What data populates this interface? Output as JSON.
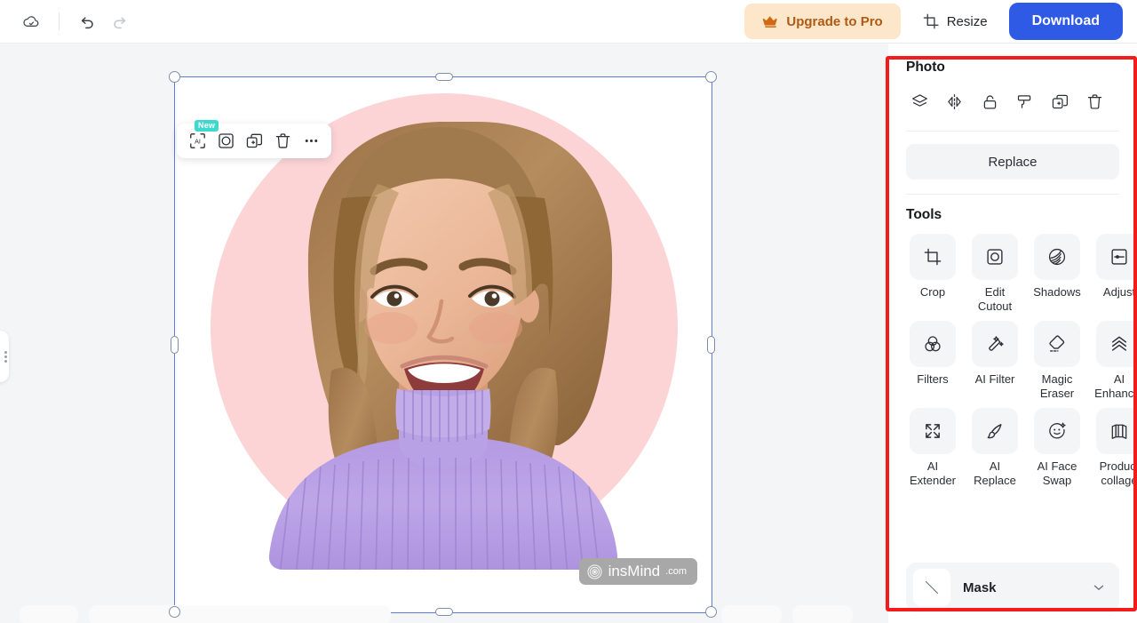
{
  "topbar": {
    "cloud_saved_icon": "cloud-check-icon",
    "undo_icon": "undo-icon",
    "redo_icon": "redo-icon",
    "upgrade_label": "Upgrade to Pro",
    "upgrade_icon": "crown-icon",
    "upgrade_bg": "#fce7cb",
    "upgrade_fg": "#b05a14",
    "resize_label": "Resize",
    "resize_icon": "crop-resize-icon",
    "download_label": "Download",
    "download_bg": "#2f5ae6"
  },
  "canvas": {
    "object_toolbar": [
      {
        "name": "ai-scan-icon",
        "badge": "New",
        "badge_color": "#3ed8cf"
      },
      {
        "name": "edit-cutout-icon",
        "badge": ""
      },
      {
        "name": "duplicate-icon",
        "badge": ""
      },
      {
        "name": "delete-icon",
        "badge": ""
      },
      {
        "name": "more-options-icon",
        "badge": ""
      }
    ],
    "selection_color": "#5f7ae0",
    "artboard_bg": "#ffffff",
    "circle_color": "#fcd4d6",
    "watermark": {
      "brand": "insMind",
      "domain": ".com",
      "logo": "spiral-logo-icon"
    }
  },
  "right_panel": {
    "photo": {
      "title": "Photo",
      "icons": [
        "layers-icon",
        "flip-horizontal-icon",
        "unlock-icon",
        "paint-roller-icon",
        "duplicate-icon",
        "delete-icon"
      ],
      "replace_label": "Replace"
    },
    "tools": {
      "title": "Tools",
      "items": [
        {
          "label": "Crop",
          "icon": "crop-icon"
        },
        {
          "label": "Edit Cutout",
          "icon": "edit-cutout-icon"
        },
        {
          "label": "Shadows",
          "icon": "shadows-icon"
        },
        {
          "label": "Adjust",
          "icon": "adjust-icon"
        },
        {
          "label": "Filters",
          "icon": "filters-icon"
        },
        {
          "label": "AI Filter",
          "icon": "ai-filter-wand-icon"
        },
        {
          "label": "Magic Eraser",
          "icon": "eraser-icon"
        },
        {
          "label": "AI Enhancer",
          "icon": "enhance-chevrons-icon"
        },
        {
          "label": "AI Extender",
          "icon": "expand-arrows-icon"
        },
        {
          "label": "AI Replace",
          "icon": "brush-icon"
        },
        {
          "label": "AI Face Swap",
          "icon": "smiley-sparkle-icon"
        },
        {
          "label": "Product collage",
          "icon": "collage-icon"
        }
      ]
    },
    "mask": {
      "label": "Mask",
      "thumb_icon": "diagonal-line-icon",
      "chevron_icon": "chevron-down-icon"
    }
  },
  "annotation": {
    "highlight_color": "#f31b1b"
  }
}
